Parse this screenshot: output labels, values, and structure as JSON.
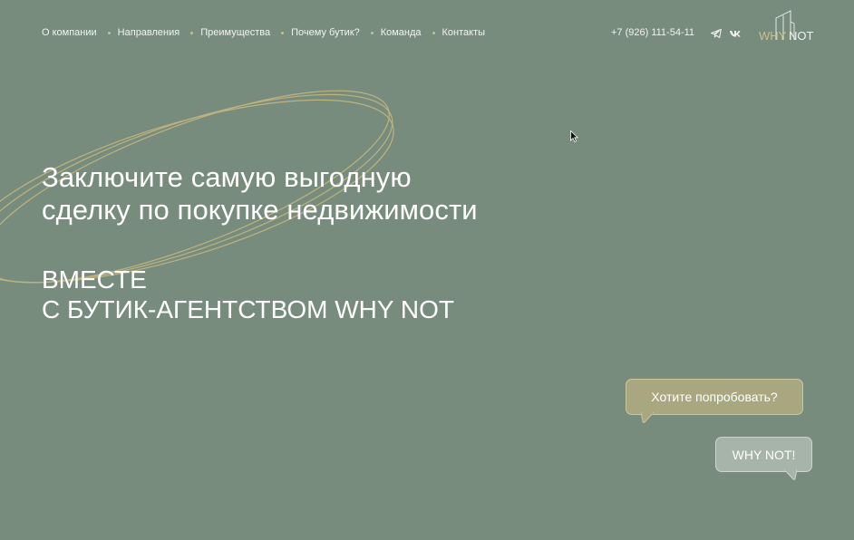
{
  "colors": {
    "background": "#788c7e",
    "accent_gold": "#c9c08a",
    "bubble_try": "#a8a77f",
    "bubble_why": "#a7b4aa",
    "text": "#ffffff"
  },
  "nav": {
    "items": [
      {
        "label": "О компании"
      },
      {
        "label": "Направления"
      },
      {
        "label": "Преимущества"
      },
      {
        "label": "Почему бутик?"
      },
      {
        "label": "Команда"
      },
      {
        "label": "Контакты"
      }
    ]
  },
  "header": {
    "phone": "+7 (926) 111-54-11",
    "social_icons": [
      "telegram-icon",
      "vk-icon"
    ],
    "logo_text_left": "WHY",
    "logo_text_right": "NOT"
  },
  "hero": {
    "headline_line1": "Заключите самую выгодную",
    "headline_line2": "сделку по покупке недвижимости",
    "sub_line1": "ВМЕСТЕ",
    "sub_line2": "С БУТИК-АГЕНТСТВОМ WHY NOT"
  },
  "chat": {
    "question": "Хотите попробовать?",
    "answer": "WHY NOT!"
  }
}
